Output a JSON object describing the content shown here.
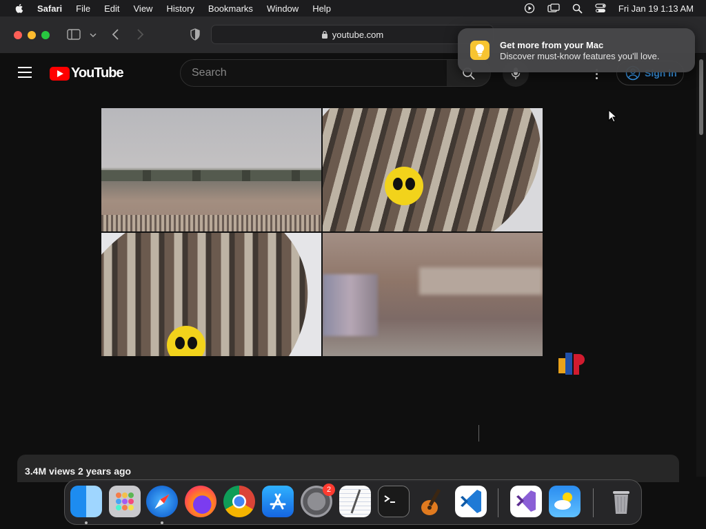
{
  "menubar": {
    "items": [
      "Safari",
      "File",
      "Edit",
      "View",
      "History",
      "Bookmarks",
      "Window",
      "Help"
    ],
    "clock": "Fri Jan 19  1:13 AM"
  },
  "browser": {
    "url": "youtube.com"
  },
  "notification": {
    "title": "Get more from your Mac",
    "body": "Discover must-know features you'll love."
  },
  "youtube": {
    "logo_text": "YouTube",
    "search_placeholder": "Search",
    "signin_label": "Sign in",
    "video": {
      "stats": "3.4M views  2 years ago"
    }
  },
  "dock": {
    "apps": [
      "finder-icon",
      "launchpad-icon",
      "safari-icon",
      "firefox-icon",
      "chrome-icon",
      "app-store-icon",
      "system-settings-icon",
      "textedit-icon",
      "terminal-icon",
      "garageband-icon",
      "vscode-icon",
      "visual-studio-icon",
      "weather-icon",
      "trash-icon"
    ],
    "system_settings_badge": "2"
  },
  "colors": {
    "youtube_red": "#ff0000",
    "signin_blue": "#3ea6ff"
  }
}
